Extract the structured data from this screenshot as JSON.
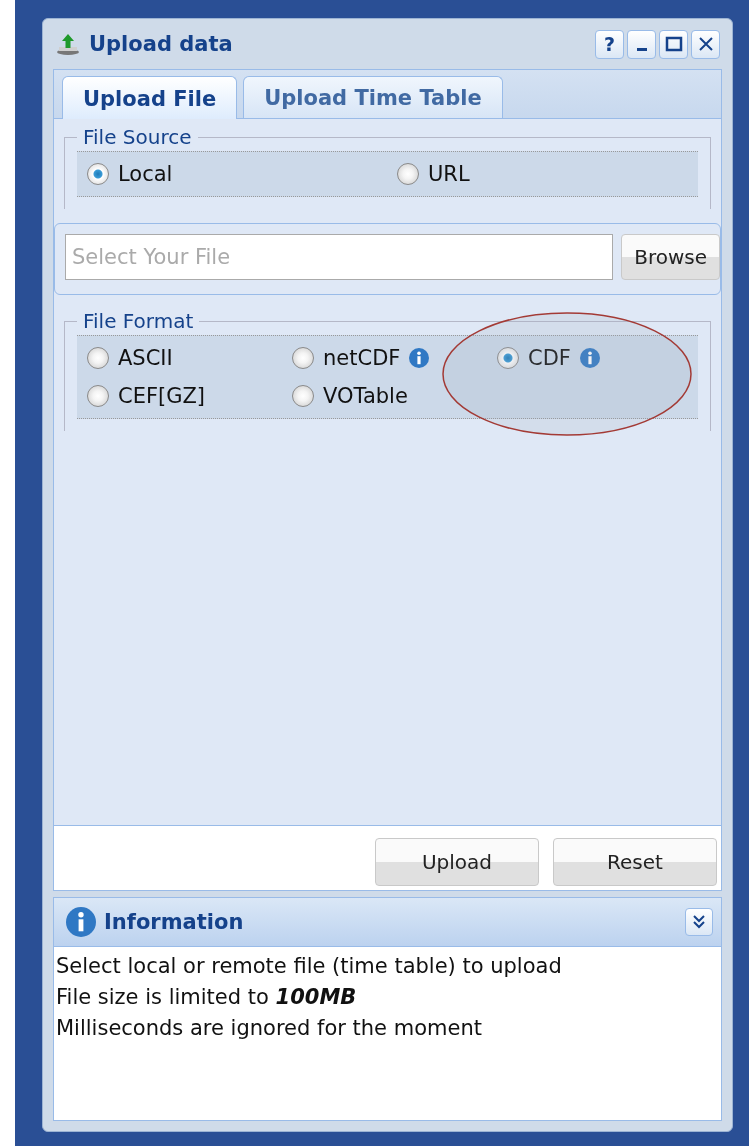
{
  "window": {
    "title": "Upload data",
    "tool_buttons": [
      {
        "kind": "help",
        "label": "?"
      },
      {
        "kind": "minimize"
      },
      {
        "kind": "maximize"
      },
      {
        "kind": "close"
      }
    ]
  },
  "tabs": [
    {
      "label": "Upload File",
      "selected": true
    },
    {
      "label": "Upload Time Table",
      "selected": false
    }
  ],
  "file_source": {
    "legend": "File Source",
    "options": [
      {
        "label": "Local",
        "selected": true
      },
      {
        "label": "URL",
        "selected": false
      }
    ]
  },
  "file_field": {
    "placeholder": "Select Your File",
    "button": "Browse"
  },
  "file_format": {
    "legend": "File Format",
    "options": [
      {
        "label": "ASCII",
        "selected": false,
        "info": false,
        "highlighted": false
      },
      {
        "label": "netCDF",
        "selected": false,
        "info": true,
        "highlighted": false
      },
      {
        "label": "CDF",
        "selected": true,
        "info": true,
        "highlighted": true
      },
      {
        "label": "CEF[GZ]",
        "selected": false,
        "info": false,
        "highlighted": false
      },
      {
        "label": "VOTable",
        "selected": false,
        "info": false,
        "highlighted": false
      }
    ]
  },
  "buttons": [
    "Upload",
    "Reset"
  ],
  "information": {
    "title": "Information",
    "expanded": true,
    "lines": [
      "Select local or remote file (time table) to upload",
      "File size is limited to **100MB**",
      "Milliseconds are ignored for the moment"
    ]
  }
}
